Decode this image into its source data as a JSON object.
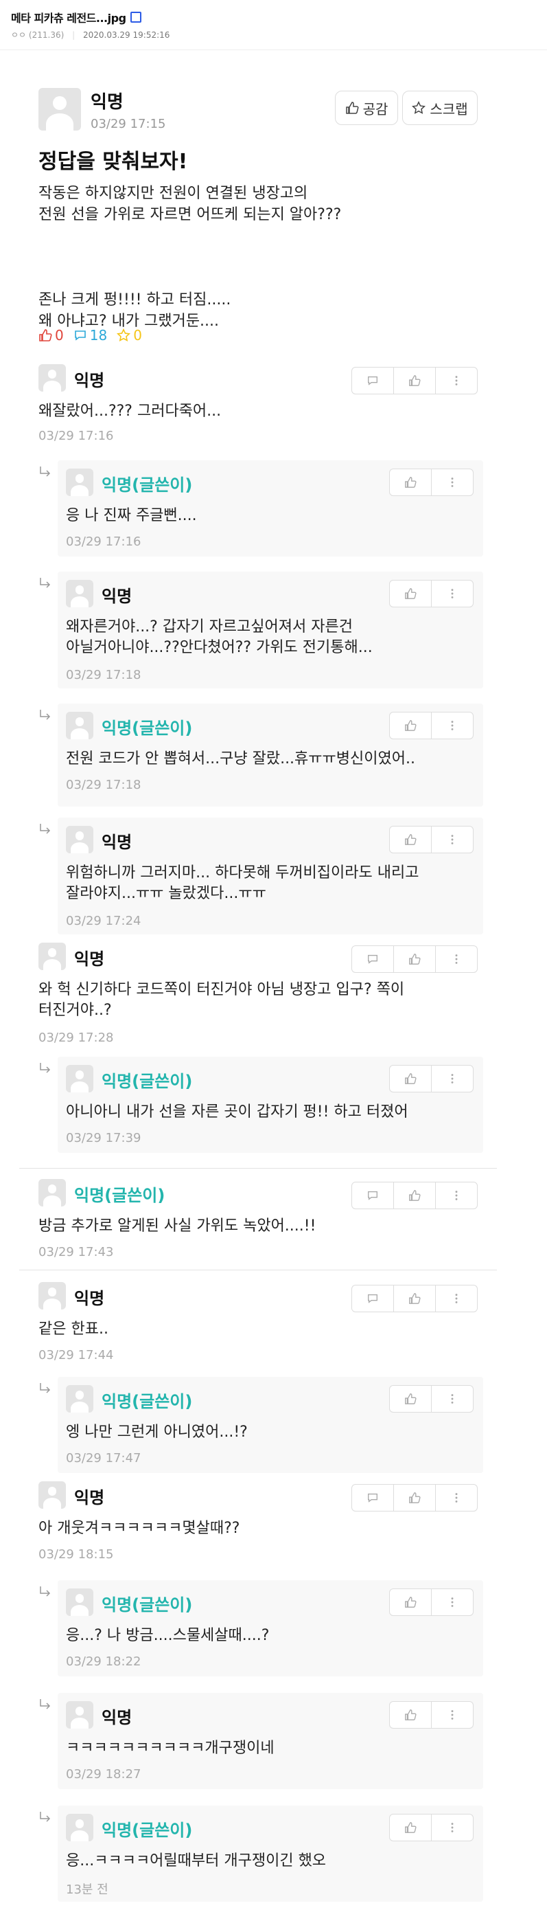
{
  "header": {
    "title": "메타 피카츄 레전드...jpg",
    "user": "ㅇㅇ",
    "ip": "(211.36)",
    "datetime": "2020.03.29 19:52:16"
  },
  "post": {
    "author": "익명",
    "time": "03/29 17:15",
    "like_label": "공감",
    "scrap_label": "스크랩",
    "title": "정답을 맞춰보자!",
    "body": "작동은 하지않지만 전원이 연결된 냉장고의\n전원 선을 가위로 자르면 어뜨케 되는지 알아???\n\n\n\n존나 크게 펑!!!! 하고 터짐.....\n왜 아냐고? 내가 그랬거둔....",
    "likes": "0",
    "comments": "18",
    "scraps": "0"
  },
  "comments": [
    {
      "nick": "익명",
      "text": "왜잘랐어...??? 그러다죽어...",
      "time": "03/29 17:16"
    },
    {
      "nick": "익명(글쓴이)",
      "text": "응 나 진짜 주글뻔....",
      "time": "03/29 17:16"
    },
    {
      "nick": "익명",
      "text": "왜자른거야...? 갑자기 자르고싶어져서 자른건\n아닐거아니야...??안다쳤어?? 가위도 전기통해...",
      "time": "03/29 17:18"
    },
    {
      "nick": "익명(글쓴이)",
      "text": "전원 코드가 안 뽑혀서...구냥 잘랐...휴ㅠㅠ병신이였어..",
      "time": "03/29 17:18"
    },
    {
      "nick": "익명",
      "text": "위험하니까 그러지마... 하다못해 두꺼비집이라도 내리고\n잘라야지...ㅠㅠ 놀랐겠다...ㅠㅠ",
      "time": "03/29 17:24"
    },
    {
      "nick": "익명",
      "text": "와 헉 신기하다 코드쪽이 터진거야 아님 냉장고 입구? 쪽이\n터진거야..?",
      "time": "03/29 17:28"
    },
    {
      "nick": "익명(글쓴이)",
      "text": "아니아니 내가 선을 자른 곳이 갑자기 펑!! 하고 터졌어",
      "time": "03/29 17:39"
    },
    {
      "nick": "익명(글쓴이)",
      "text": "방금 추가로 알게된 사실 가위도 녹았어....!!",
      "time": "03/29 17:43"
    },
    {
      "nick": "익명",
      "text": "같은 한표..",
      "time": "03/29 17:44"
    },
    {
      "nick": "익명(글쓴이)",
      "text": "엥 나만 그런게 아니였어...!?",
      "time": "03/29 17:47"
    },
    {
      "nick": "익명",
      "text": "아 개웃겨ㅋㅋㅋㅋㅋㅋ몇살때??",
      "time": "03/29 18:15"
    },
    {
      "nick": "익명(글쓴이)",
      "text": "응...? 나 방금....스물세살때....?",
      "time": "03/29 18:22"
    },
    {
      "nick": "익명",
      "text": "ㅋㅋㅋㅋㅋㅋㅋㅋㅋㅋ개구쟁이네",
      "time": "03/29 18:27"
    },
    {
      "nick": "익명(글쓴이)",
      "text": "응...ㅋㅋㅋㅋ어릴때부터 개구쟁이긴 했오",
      "time": "13분 전"
    }
  ],
  "colors": {
    "writer": "#23b5ad",
    "like": "#e0443a",
    "comment": "#2ba8d8",
    "scrap": "#f5c518"
  }
}
